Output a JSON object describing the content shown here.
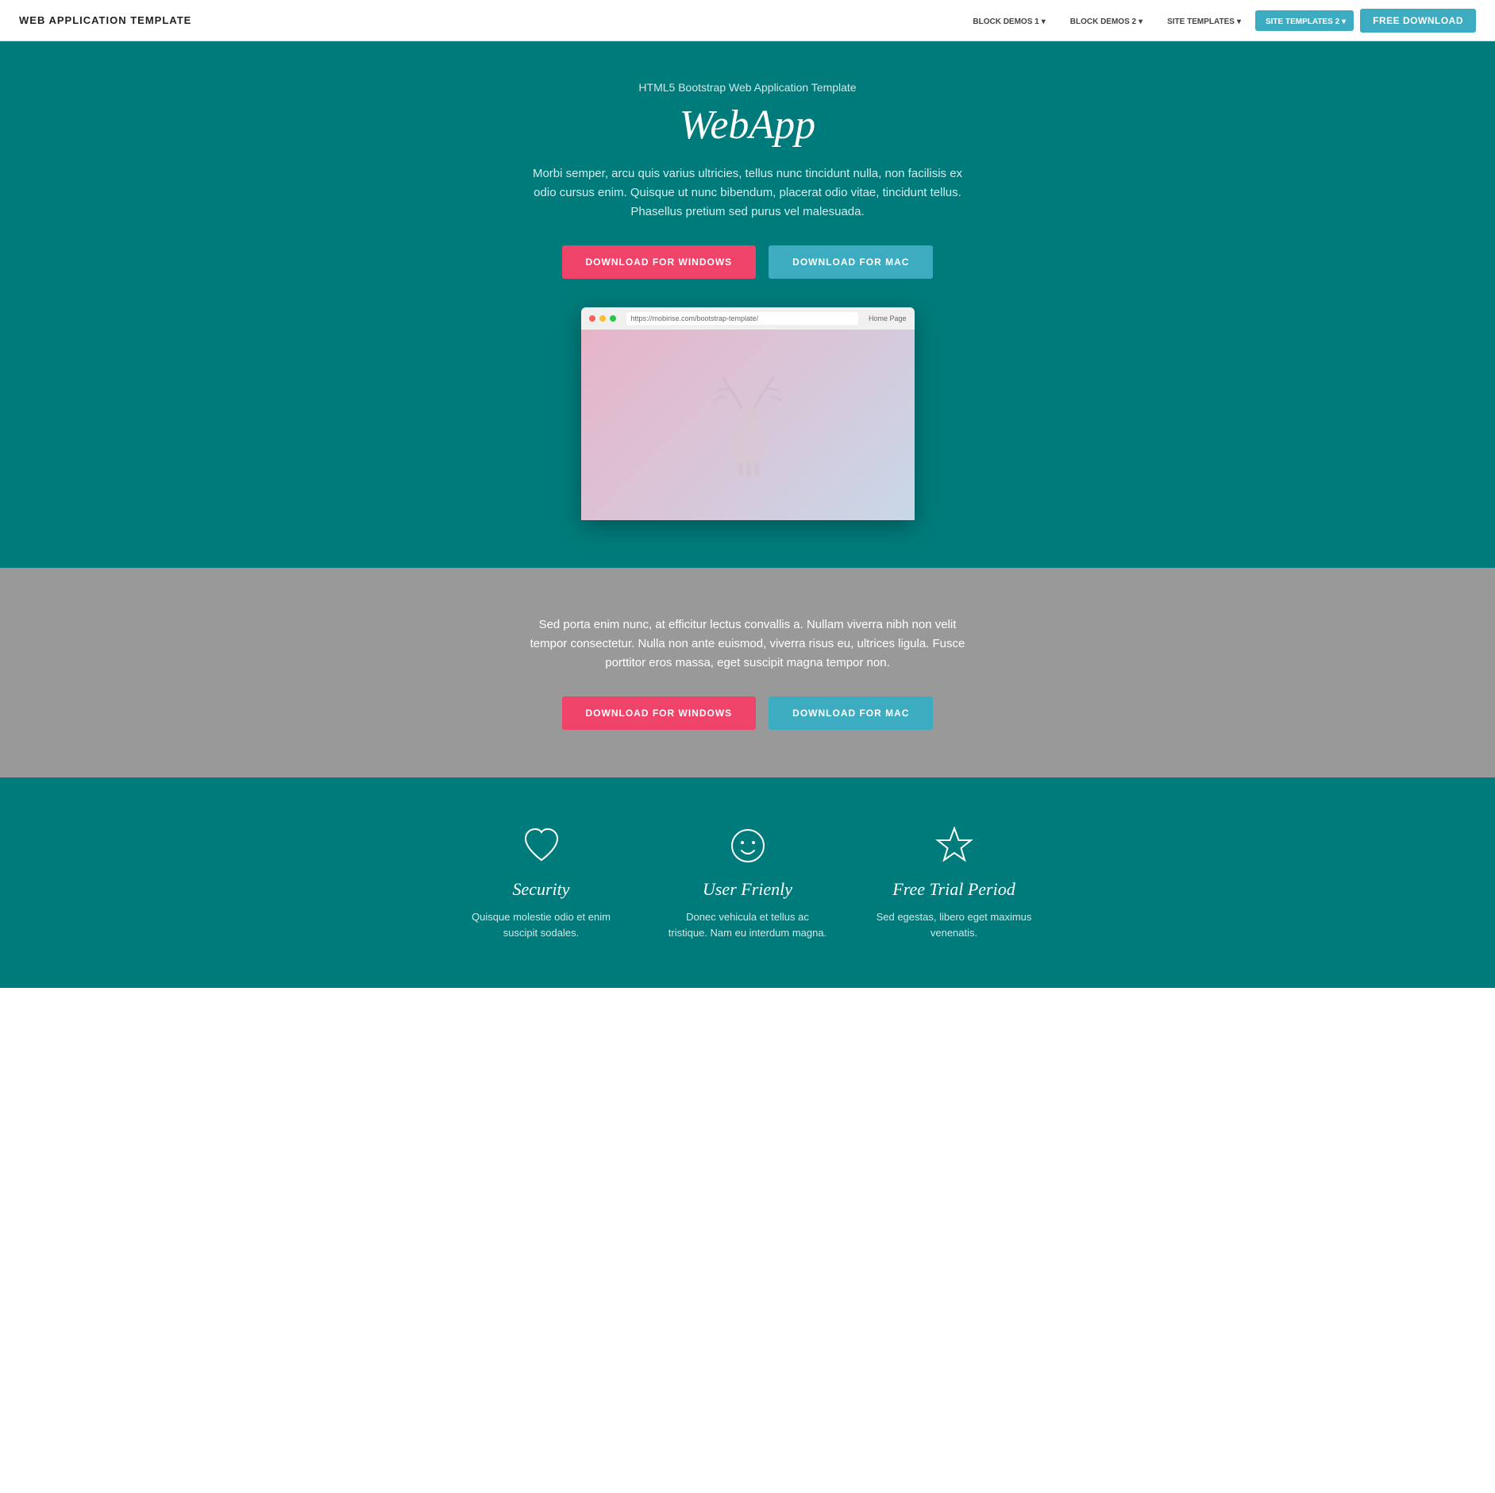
{
  "navbar": {
    "brand": "WEB APPLICATION TEMPLATE",
    "links": [
      {
        "label": "BLOCK DEMOS 1",
        "dropdown": true
      },
      {
        "label": "BLOCK DEMOS 2",
        "dropdown": true
      },
      {
        "label": "SITE TEMPLATES",
        "dropdown": true
      },
      {
        "label": "SITE TEMPLATES 2",
        "dropdown": true,
        "active": true
      }
    ],
    "cta": "FREE DOWNLOAD"
  },
  "hero": {
    "subtitle": "HTML5 Bootstrap Web Application Template",
    "title": "WebApp",
    "description": "Morbi semper, arcu quis varius ultricies, tellus nunc tincidunt nulla, non facilisis ex odio cursus enim. Quisque ut nunc bibendum, placerat odio vitae, tincidunt tellus. Phasellus pretium sed purus vel malesuada.",
    "btn_windows": "DOWNLOAD FOR WINDOWS",
    "btn_mac": "DOWNLOAD FOR MAC",
    "browser_url": "https://mobirise.com/bootstrap-template/",
    "browser_home": "Home Page"
  },
  "gray_section": {
    "description": "Sed porta enim nunc, at efficitur lectus convallis a. Nullam viverra nibh non velit tempor consectetur. Nulla non ante euismod, viverra risus eu, ultrices ligula. Fusce porttitor eros massa, eget suscipit magna tempor non.",
    "btn_windows": "DOWNLOAD FOR WINDOWS",
    "btn_mac": "DOWNLOAD FOR MAC"
  },
  "features": [
    {
      "icon": "heart",
      "title": "Security",
      "description": "Quisque molestie odio et enim suscipit sodales."
    },
    {
      "icon": "smile",
      "title": "User Frienly",
      "description": "Donec vehicula et tellus ac tristique. Nam eu interdum magna."
    },
    {
      "icon": "star",
      "title": "Free Trial Period",
      "description": "Sed egestas, libero eget maximus venenatis."
    }
  ]
}
